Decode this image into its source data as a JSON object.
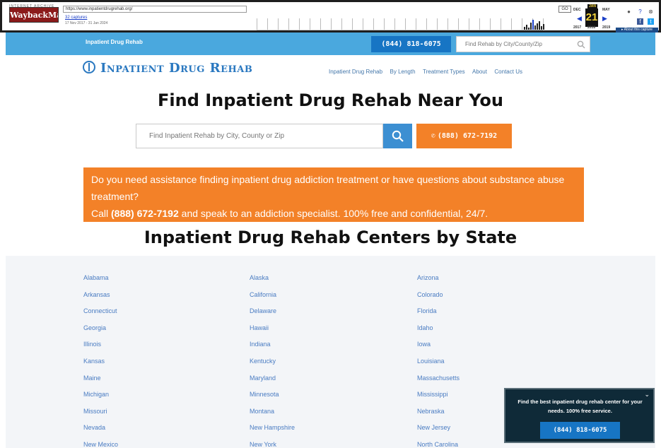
{
  "wayback": {
    "logo": "INTERNET ARCHIVE",
    "logo_mark": "WaybackMachine",
    "url": "https://www.inpatientdrugrehab.org/",
    "captures": "32 captures",
    "date_range": "17 Nov 2017 - 31 Jan 2024",
    "go": "GO",
    "months": [
      "DEC",
      "JAN",
      "MAY"
    ],
    "day": "21",
    "years": [
      "2017",
      "2018",
      "2019"
    ],
    "about": "▸ About this capture"
  },
  "topbar": {
    "title": "Inpatient Drug Rehab",
    "phone": "(844) 818-6075",
    "search_placeholder": "Find Rehab by City/County/Zip"
  },
  "header": {
    "logo": "Inpatient Drug Rehab",
    "nav": [
      "Inpatient Drug Rehab",
      "By Length",
      "Treatment Types",
      "About",
      "Contact Us"
    ]
  },
  "hero": {
    "title": "Find Inpatient Drug Rehab Near You",
    "search_placeholder": "Find Inpatient Rehab by City, County or Zip",
    "call_label": "(888) 672-7192"
  },
  "banner": {
    "line1": "Do you need assistance finding inpatient drug addiction treatment or have questions about substance abuse treatment?",
    "call_prefix": "Call",
    "phone": "(888) 672-7192",
    "call_suffix": "and speak to an addiction specialist. 100% free and confidential, 24/7."
  },
  "states_section": {
    "title": "Inpatient Drug Rehab Centers by State",
    "col1": [
      "Alabama",
      "Arkansas",
      "Connecticut",
      "Georgia",
      "Illinois",
      "Kansas",
      "Maine",
      "Michigan",
      "Missouri",
      "Nevada",
      "New Mexico"
    ],
    "col2": [
      "Alaska",
      "California",
      "Delaware",
      "Hawaii",
      "Indiana",
      "Kentucky",
      "Maryland",
      "Minnesota",
      "Montana",
      "New Hampshire",
      "New York"
    ],
    "col3": [
      "Arizona",
      "Colorado",
      "Florida",
      "Idaho",
      "Iowa",
      "Louisiana",
      "Massachusetts",
      "Mississippi",
      "Nebraska",
      "New Jersey",
      "North Carolina"
    ]
  },
  "floating": {
    "text": "Find the best inpatient drug rehab center for your needs. 100% free service.",
    "phone": "(844) 818-6075",
    "close": "⌄"
  }
}
